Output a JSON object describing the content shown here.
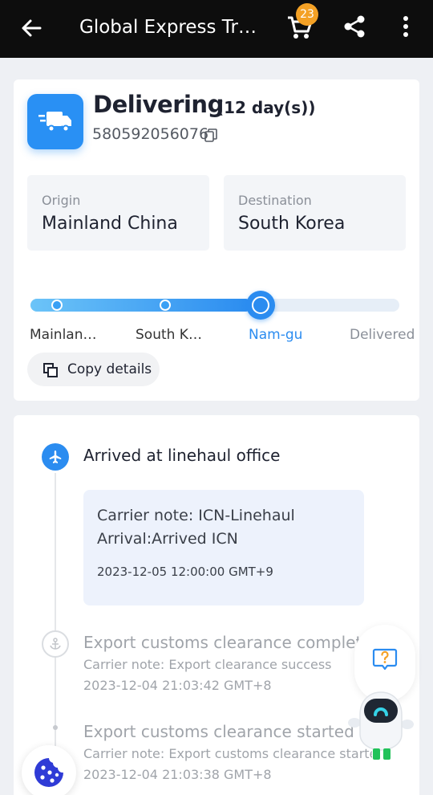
{
  "appbar": {
    "title": "Global Express Tra…",
    "cart_count": "23",
    "icons": {
      "back": "arrow-left-icon",
      "cart": "cart-icon",
      "share": "share-icon",
      "more": "more-vertical-icon"
    }
  },
  "summary": {
    "status": "Delivering",
    "duration": "(12 day(s))",
    "tracking_number": "580592056076",
    "origin": {
      "label": "Origin",
      "value": "Mainland China"
    },
    "destination": {
      "label": "Destination",
      "value": "South Korea"
    },
    "progress": 0.6,
    "stops": [
      {
        "label": "Mainlan…",
        "state": "done"
      },
      {
        "label": "South K…",
        "state": "done"
      },
      {
        "label": "Nam-gu",
        "state": "current"
      },
      {
        "label": "Delivered",
        "state": "pending"
      }
    ],
    "copy_details_label": "Copy details"
  },
  "timeline": {
    "events": [
      {
        "title": "Arrived at linehaul office",
        "note_line1": "Carrier note: ICN-Linehaul",
        "note_line2": "Arrival:Arrived ICN",
        "time": "2023-12-05 12:00:00 GMT+9",
        "icon": "airplane-icon",
        "active": true
      },
      {
        "title": "Export customs clearance complete",
        "note": "Carrier note: Export clearance success",
        "time": "2023-12-04 21:03:42 GMT+8",
        "icon": "anchor-icon",
        "active": false
      },
      {
        "title": "Export customs clearance started",
        "note": "Carrier note: Export customs clearance started",
        "time": "2023-12-04 21:03:38 GMT+8",
        "icon": "dot-icon",
        "active": false
      }
    ]
  },
  "colors": {
    "accent": "#2b8cf0",
    "badge": "#f4a125",
    "appbar": "#0d0d0d"
  }
}
